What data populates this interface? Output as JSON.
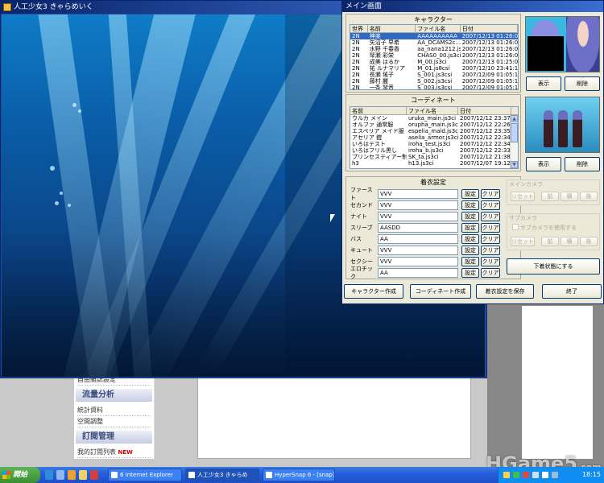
{
  "game_window": {
    "title": "人工少女3 きゃらめいく"
  },
  "main_window": {
    "title": "メイン画面",
    "character_group": {
      "title": "キャラクター",
      "columns": [
        "世界",
        "名前",
        "ファイル名",
        "日付"
      ],
      "rows": [
        [
          "2N",
          "神楽",
          "AAAAAAAAAA",
          "2007/12/13 01:26:00"
        ],
        [
          "2N",
          "矢沼子 早希",
          "AA_DCAMS2c...",
          "2007/12/13 01:26:00"
        ],
        [
          "2N",
          "水野 千春香",
          "aa_nana1212.js...",
          "2007/12/13 01:26:00"
        ],
        [
          "2N",
          "琴瀬 彩栄",
          "CHAS0_00.js3ci",
          "2007/12/13 01:26:00"
        ],
        [
          "2N",
          "成美 はるか",
          "M_00.js3ci",
          "2007/12/13 01:25:00"
        ],
        [
          "2N",
          "祐 ルナマリア",
          "M_01.js8csi",
          "2007/12/10 23:41:17"
        ],
        [
          "2N",
          "長瀬 瑤子",
          "S_001.js3csi",
          "2007/12/09 01:05:13"
        ],
        [
          "2N",
          "藤村 麗",
          "S_002.js3csi",
          "2007/12/09 01:05:13"
        ],
        [
          "2N",
          "一条 琴音",
          "S_003.js3csi",
          "2007/12/09 01:05:13"
        ]
      ],
      "show_label": "表示",
      "delete_label": "削除"
    },
    "coordinate_group": {
      "title": "コーディネート",
      "columns": [
        "名前",
        "ファイル名",
        "日付"
      ],
      "rows": [
        [
          "ウルカ メイン",
          "uruka_main.js3ci",
          "2007/12/12 23:37:01"
        ],
        [
          "オルファ 通常服",
          "orupha_main.js3ci",
          "2007/12/12 22:26:16"
        ],
        [
          "エスペリア メイド服",
          "espelia_maid.js3ci",
          "2007/12/12 23:35:16"
        ],
        [
          "アセリア 鎧",
          "aselia_armor.js3ci",
          "2007/12/12 22:34:17"
        ],
        [
          "いろはテスト",
          "iroha_test.js3ci",
          "2007/12/12 22:34:01"
        ],
        [
          "いろはフリル黒し",
          "iroha_b.js3ci",
          "2007/12/12 22:33:18"
        ],
        [
          "プリンセスティアー制服服",
          "SK_ta.js3ci",
          "2007/12/12 21:38:26"
        ],
        [
          "h3",
          "h13.js3ci",
          "2007/12/07 19:12:34"
        ]
      ],
      "show_label": "表示",
      "delete_label": "削除"
    },
    "settings_group": {
      "title": "着衣設定",
      "rows": [
        {
          "label": "ファースト",
          "value": "VVV"
        },
        {
          "label": "セカンド",
          "value": "VVV"
        },
        {
          "label": "ナイト",
          "value": "VVV"
        },
        {
          "label": "スリーブ",
          "value": "AASDD"
        },
        {
          "label": "バス",
          "value": "AA"
        },
        {
          "label": "キュート",
          "value": "VVV"
        },
        {
          "label": "セクシー",
          "value": "VVV"
        },
        {
          "label": "エロチック",
          "value": "AA"
        }
      ],
      "set_label": "設定",
      "clear_label": "クリア"
    },
    "main_camera": {
      "title": "メインカメラ",
      "reset_label": "リセット",
      "b1": "前",
      "b2": "横",
      "b3": "後"
    },
    "sub_camera": {
      "title": "サブカメラ",
      "use_label": "サブカメラを使用する",
      "reset_label": "リセット",
      "b1": "前",
      "b2": "横",
      "b3": "後"
    },
    "bottom_buttons": {
      "create_character": "キャラクター作成",
      "create_coordinate": "コーディネート作成",
      "save_settings": "着衣設定を保存",
      "exit": "終了"
    },
    "preview_button": "下着状態にする"
  },
  "background_page": {
    "items_top": "自由雜誌設定",
    "section1": "流量分析",
    "item1": "統計資料",
    "item2": "空間調整",
    "section2": "訂閱管理",
    "item3": "我的訂閱列表",
    "new_badge": "NEW"
  },
  "taskbar": {
    "start_label": "開始",
    "tasks": [
      "6 Internet Explorer",
      "人工少女3 きゃらめ",
      "HyperSnap 6 - [snap7..."
    ],
    "clock": "18:15"
  },
  "watermark": {
    "main": "HGame5",
    "suffix": ".com"
  }
}
